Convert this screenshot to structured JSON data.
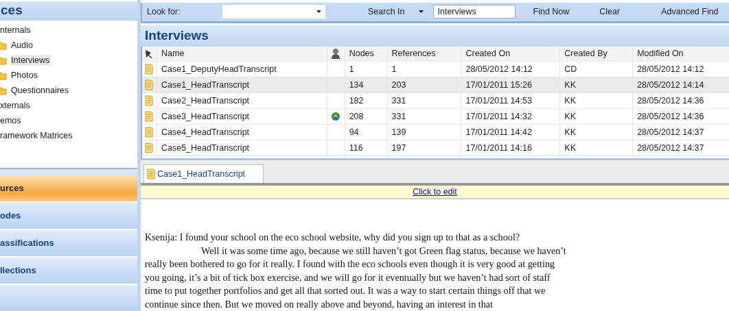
{
  "sidebar": {
    "title": "ces",
    "tree": [
      {
        "label": "nternals",
        "selected": false,
        "children": [
          {
            "label": "Audio",
            "selected": false
          },
          {
            "label": "Interviews",
            "selected": true
          },
          {
            "label": "Photos",
            "selected": false
          },
          {
            "label": "Questionnaires",
            "selected": false
          }
        ]
      },
      {
        "label": "xternals",
        "selected": false
      },
      {
        "label": "emos",
        "selected": false
      },
      {
        "label": "ramework Matrices",
        "selected": false
      }
    ],
    "nav": [
      {
        "label": "urces",
        "selected": true
      },
      {
        "label": "odes",
        "selected": false
      },
      {
        "label": "assifications",
        "selected": false
      },
      {
        "label": "llections",
        "selected": false
      }
    ]
  },
  "search_bar": {
    "look_for_label": "Look for:",
    "search_in_label": "Search In",
    "search_in_value": "Interviews",
    "buttons": [
      "Find Now",
      "Clear",
      "Advanced Find"
    ]
  },
  "list_title": "Interviews",
  "table": {
    "columns": [
      "Name",
      "Nodes",
      "References",
      "Created On",
      "Created By",
      "Modified On"
    ],
    "rows": [
      {
        "linked": false,
        "selected": false,
        "cells": [
          "Case1_DeputyHeadTranscript",
          "1",
          "1",
          "28/05/2012 14:12",
          "CD",
          "28/05/2012 14:12"
        ]
      },
      {
        "linked": false,
        "selected": true,
        "cells": [
          "Case1_HeadTranscript",
          "134",
          "203",
          "17/01/2011 15:26",
          "KK",
          "28/05/2012 14:14"
        ]
      },
      {
        "linked": false,
        "selected": false,
        "cells": [
          "Case2_HeadTranscript",
          "182",
          "331",
          "17/01/2011 14:53",
          "KK",
          "28/05/2012 14:36"
        ]
      },
      {
        "linked": true,
        "selected": false,
        "cells": [
          "Case3_HeadTranscript",
          "208",
          "331",
          "17/01/2011 14:32",
          "KK",
          "28/05/2012 14:36"
        ]
      },
      {
        "linked": false,
        "selected": false,
        "cells": [
          "Case4_HeadTranscript",
          "94",
          "139",
          "17/01/2011 14:42",
          "KK",
          "28/05/2012 14:37"
        ]
      },
      {
        "linked": false,
        "selected": false,
        "cells": [
          "Case5_HeadTranscript",
          "116",
          "197",
          "17/01/2011 14:16",
          "KK",
          "28/05/2012 14:37"
        ]
      }
    ]
  },
  "document": {
    "tab": "Case1_HeadTranscript",
    "edit_link": "Click to edit",
    "paragraphs": [
      {
        "indent": false,
        "lines": [
          "Ksenija: I found your school on the eco school website, why did you sign up to that as a school?"
        ]
      },
      {
        "indent": true,
        "lines": [
          "Well it was some time ago, because we still haven’t got Green flag status, because we haven’t",
          "really been bothered to go for it really. I found with the eco schools even though it is very good at getting",
          "you going, it’s a bit of tick box exercise, and we will go for it eventually but we haven’t had sort of staff",
          "time to put together portfolios and get all that sorted out. It was a way to start certain things off that we",
          "continue since then. But we moved on really above and beyond, having an interest in that"
        ]
      }
    ]
  }
}
